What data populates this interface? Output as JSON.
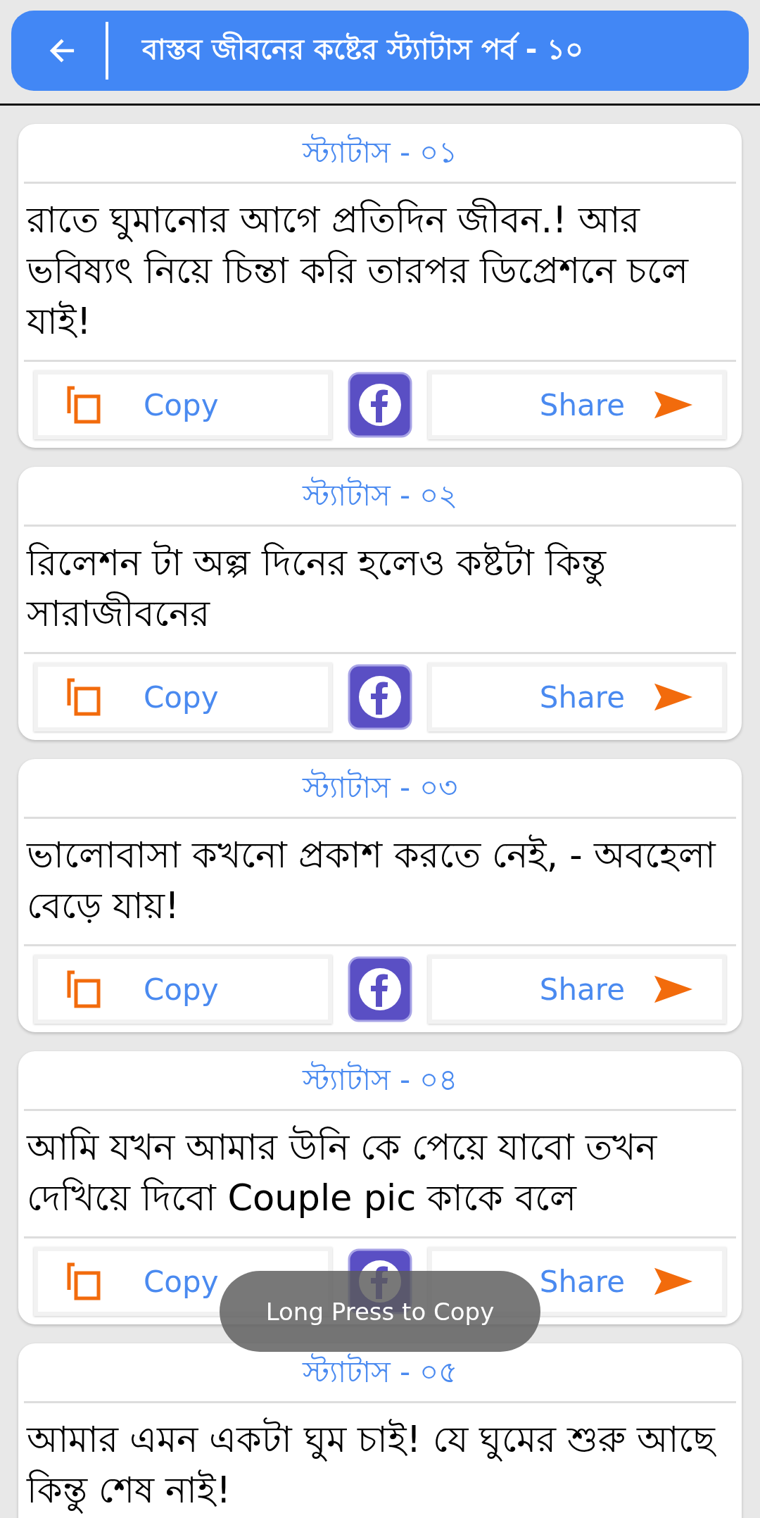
{
  "app_bar": {
    "title": "বাস্তব জীবনের কষ্টের স্ট্যাটাস পর্ব - ১০"
  },
  "cards": [
    {
      "title": "স্ট্যাটাস - ০১",
      "text": "রাতে ঘুমানোর আগে প্রতিদিন জীবন.! আর ভবিষ্যৎ নিয়ে চিন্তা করি তারপর ডিপ্রেশনে চলে যাই!",
      "copy_label": "Copy",
      "share_label": "Share"
    },
    {
      "title": "স্ট্যাটাস - ০২",
      "text": "রিলেশন টা অল্প দিনের হলেও কষ্টটা কিন্তু সারাজীবনের",
      "copy_label": "Copy",
      "share_label": "Share"
    },
    {
      "title": "স্ট্যাটাস - ০৩",
      "text": "ভালোবাসা কখনো প্রকাশ করতে নেই, - অবহেলা বেড়ে যায়!",
      "copy_label": "Copy",
      "share_label": "Share"
    },
    {
      "title": "স্ট্যাটাস - ০৪",
      "text": "আমি যখন আমার উনি কে পেয়ে যাবো তখন দেখিয়ে দিবো Couple pic কাকে বলে",
      "copy_label": "Copy",
      "share_label": "Share"
    },
    {
      "title": "স্ট্যাটাস - ০৫",
      "text": "আমার এমন একটা ঘুম চাই! যে ঘুমের শুরু আছে কিন্তু শেষ নাই!"
    }
  ],
  "toast": "Long Press to Copy"
}
